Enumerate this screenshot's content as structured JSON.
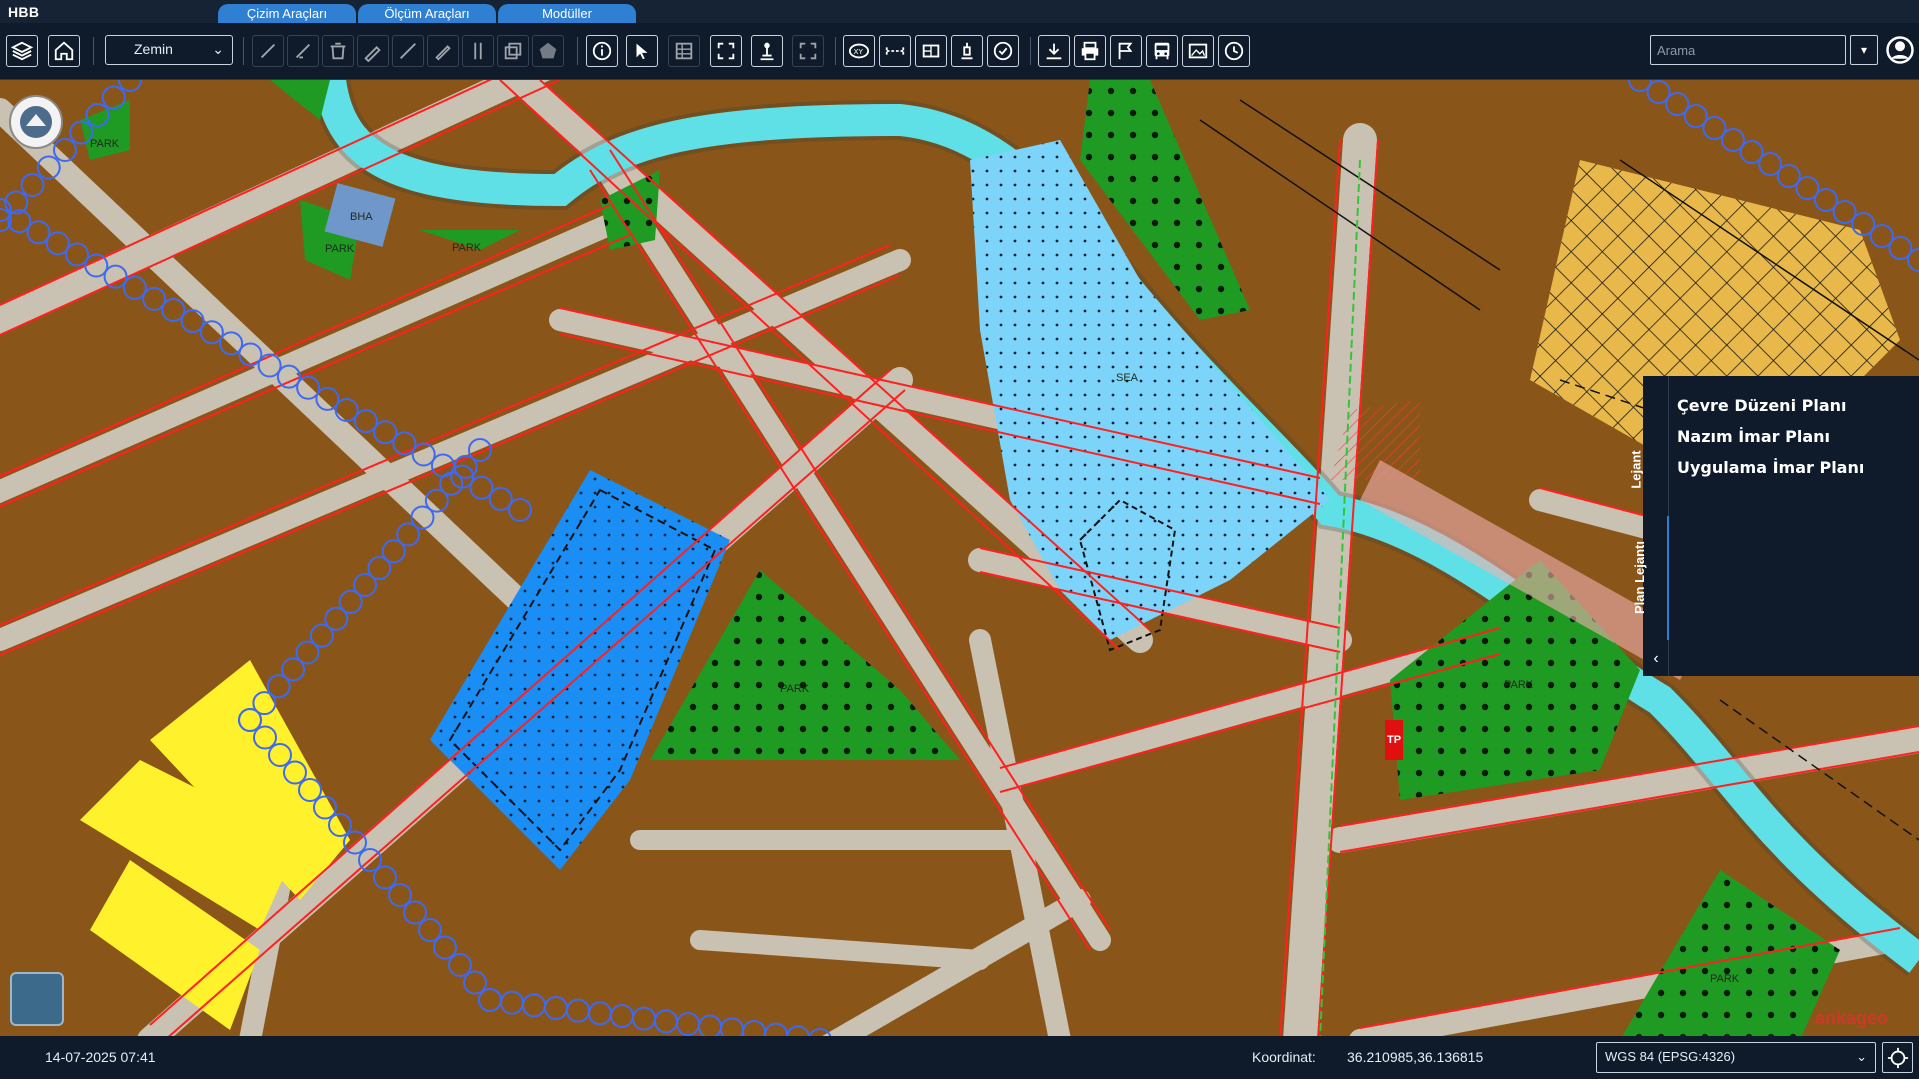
{
  "app": {
    "title": "HBB"
  },
  "top_tabs": [
    {
      "label": "Çizim Araçları"
    },
    {
      "label": "Ölçüm Araçları"
    },
    {
      "label": "Modüller"
    }
  ],
  "toolbar": {
    "layer_select": {
      "value": "Zemin"
    },
    "search": {
      "placeholder": "Arama"
    },
    "icons": [
      "layers-icon",
      "home-icon",
      "draw-point-icon",
      "draw-line-icon",
      "delete-icon",
      "edit-icon",
      "measure-line-icon",
      "pen-icon",
      "column-icon",
      "copy-icon",
      "polygon-icon",
      "info-icon",
      "select-cursor-icon",
      "table-icon",
      "fullscreen-icon",
      "pin-icon",
      "zoom-extent-icon",
      "xy-coordinate-icon",
      "distance-icon",
      "area-icon",
      "export-icon",
      "check-icon",
      "download-icon",
      "print-icon",
      "flag-icon",
      "bus-icon",
      "image-edit-icon",
      "clock-icon"
    ]
  },
  "legend": {
    "tabs": [
      {
        "label": "Lejant"
      },
      {
        "label": "Plan Lejantı"
      }
    ],
    "items": [
      {
        "label": "Çevre Düzeni Planı"
      },
      {
        "label": "Nazım İmar Planı"
      },
      {
        "label": "Uygulama İmar Planı"
      }
    ]
  },
  "map": {
    "labels": [
      "PARK",
      "PARK",
      "PARK",
      "PARK",
      "PARK",
      "PARK",
      "BHA",
      "SEA",
      "TP"
    ],
    "watermark": "ankageo",
    "colors": {
      "residential": "#8a5519",
      "park": "#1f9a22",
      "water": "#5fe0e6",
      "education": "#1a8ef5",
      "health": "#7cd4fa",
      "commercial": "#fff12b",
      "industry": "#e8b84a",
      "road": "#c8c0b0",
      "boundary": "#ff1f1f",
      "pipeline": "#3d6af0"
    }
  },
  "status": {
    "datetime": "14-07-2025 07:41",
    "coord_label": "Koordinat:",
    "coord_value": "36.210985,36.136815",
    "crs": "WGS 84 (EPSG:4326)"
  }
}
